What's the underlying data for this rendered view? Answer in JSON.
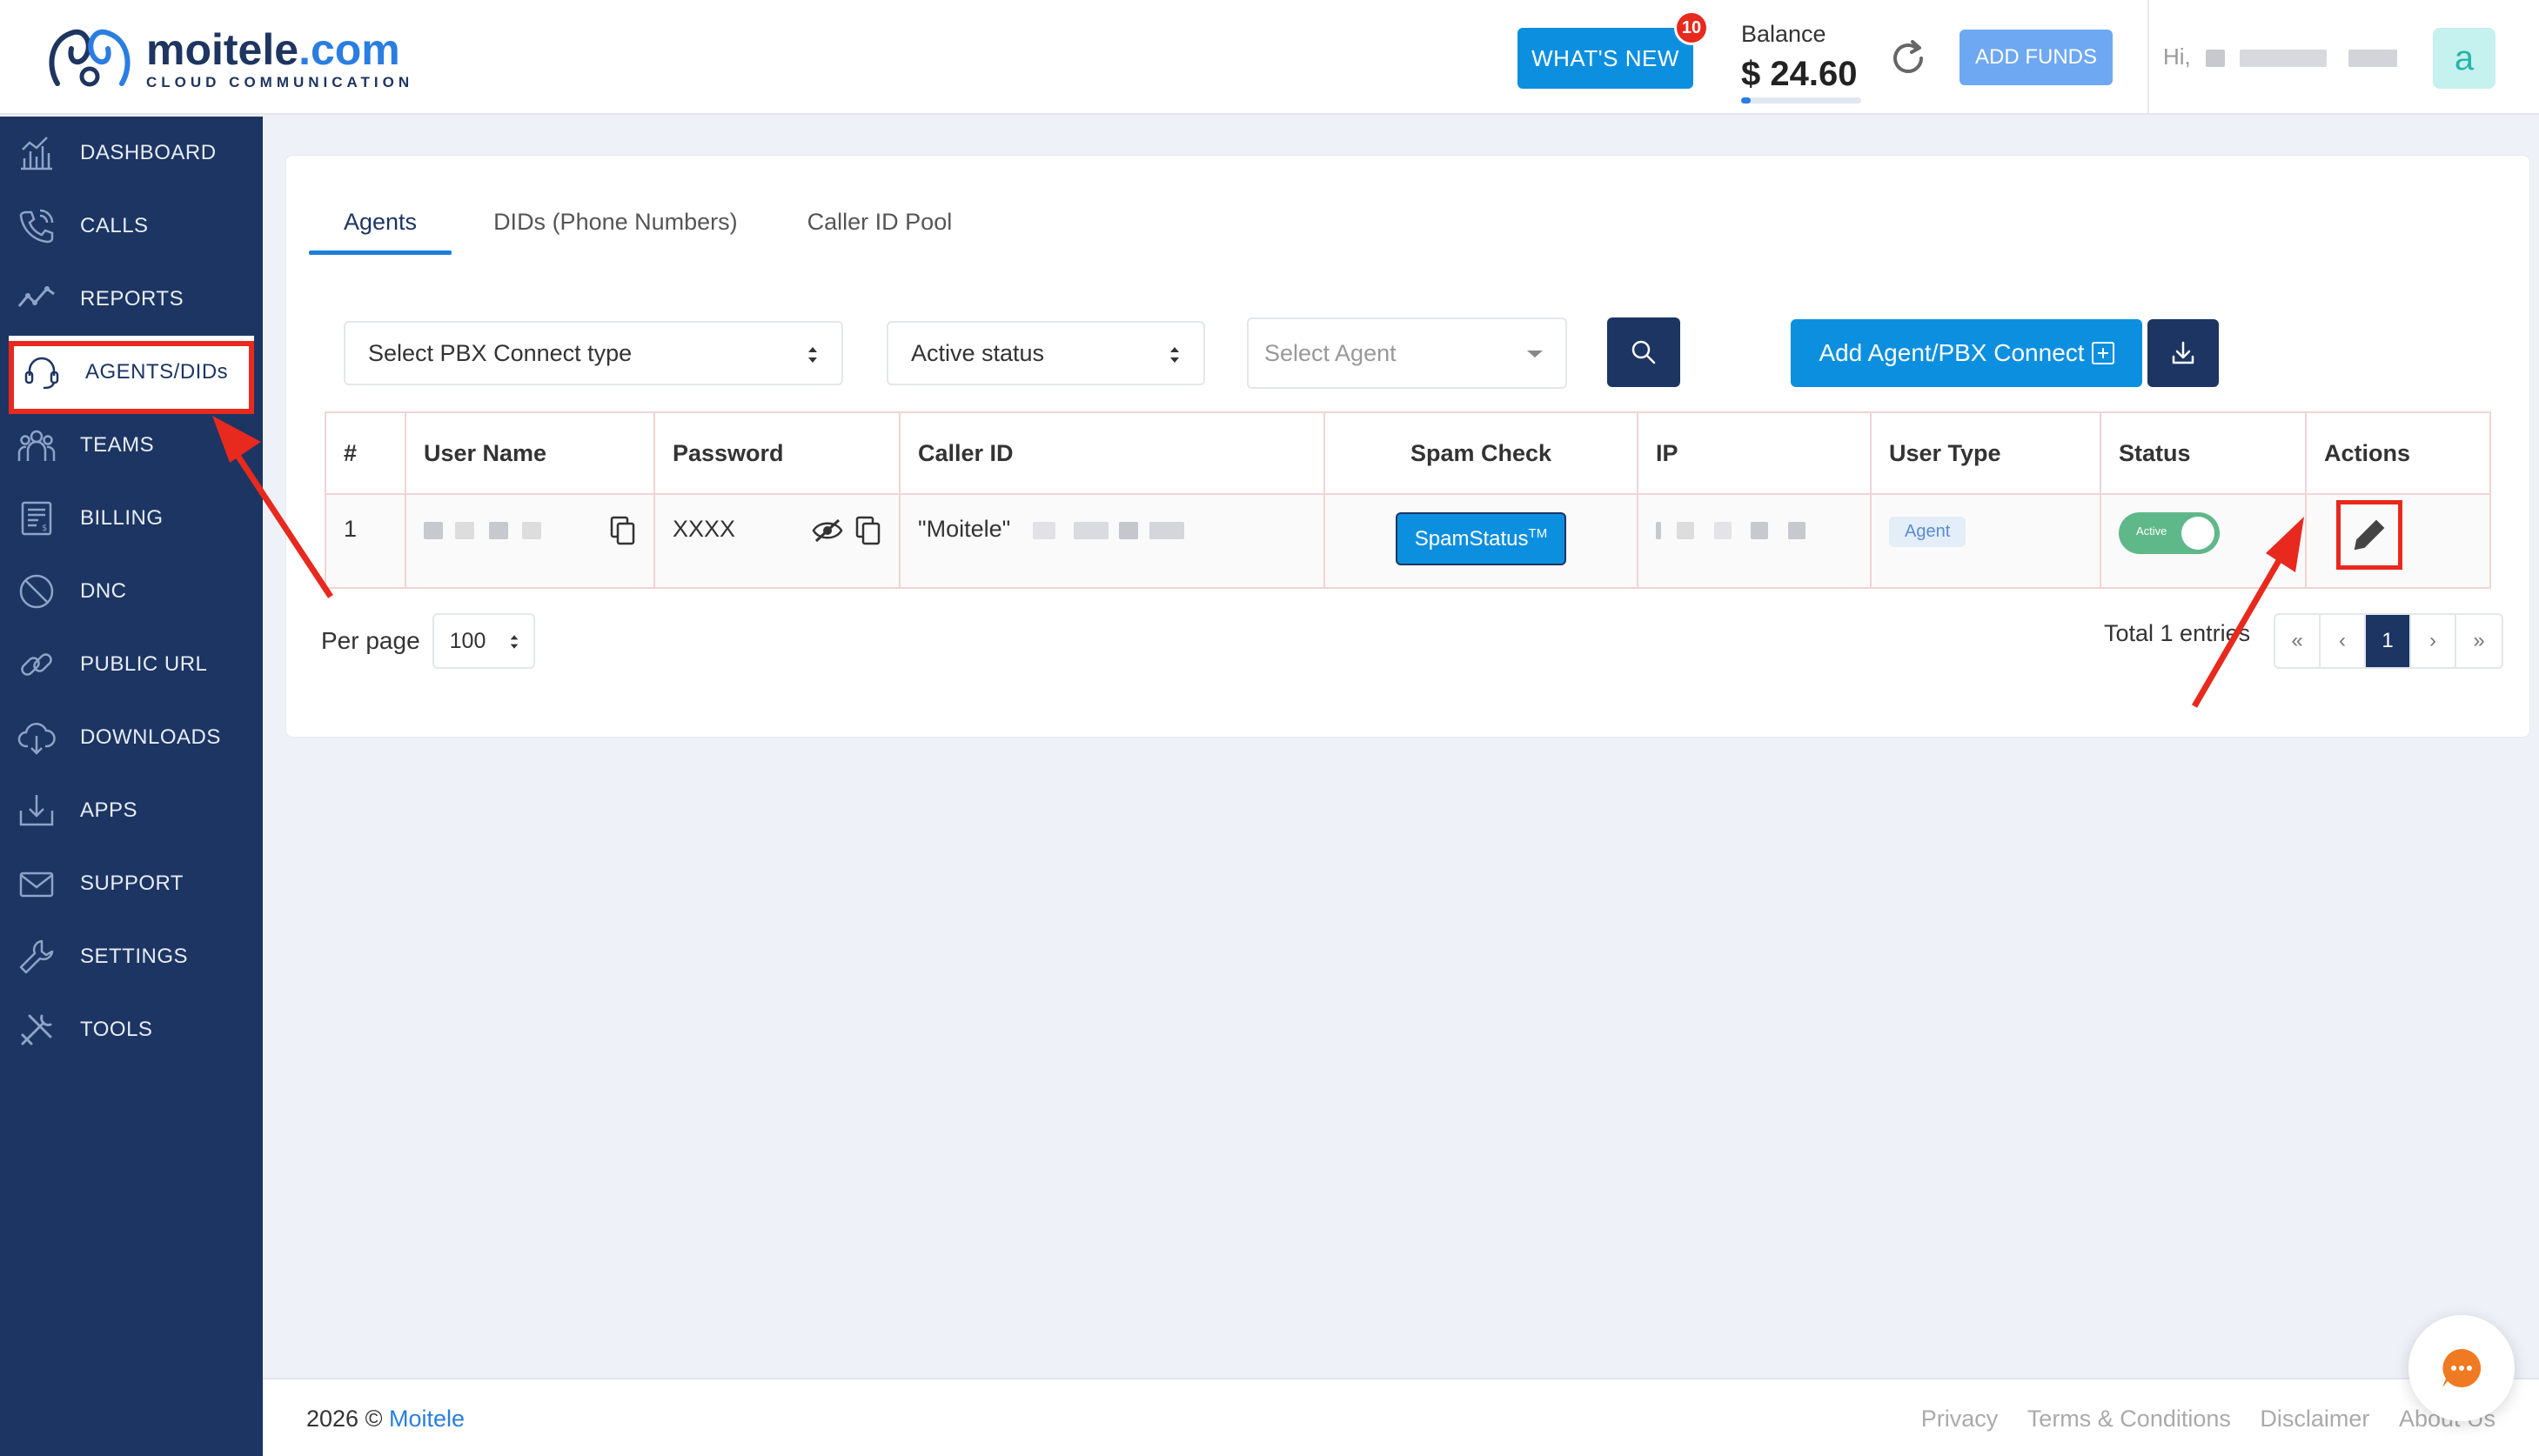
{
  "brand": {
    "name_prefix": "moitele",
    "name_suffix": ".com",
    "tagline": "CLOUD COMMUNICATION"
  },
  "header": {
    "whats_new": "WHAT'S NEW",
    "whats_new_count": "10",
    "balance_label": "Balance",
    "balance_value": "$ 24.60",
    "balance_fill_pct": 8,
    "add_funds": "ADD FUNDS",
    "greeting": "Hi,",
    "avatar_letter": "a"
  },
  "sidebar": {
    "items": [
      {
        "label": "DASHBOARD",
        "icon": "dashboard-icon"
      },
      {
        "label": "CALLS",
        "icon": "calls-icon"
      },
      {
        "label": "REPORTS",
        "icon": "reports-icon"
      },
      {
        "label": "AGENTS/DIDs",
        "icon": "headset-icon",
        "active": true
      },
      {
        "label": "TEAMS",
        "icon": "teams-icon"
      },
      {
        "label": "BILLING",
        "icon": "billing-icon"
      },
      {
        "label": "DNC",
        "icon": "dnc-icon"
      },
      {
        "label": "PUBLIC URL",
        "icon": "link-icon"
      },
      {
        "label": "DOWNLOADS",
        "icon": "cloud-download-icon"
      },
      {
        "label": "APPS",
        "icon": "apps-icon"
      },
      {
        "label": "SUPPORT",
        "icon": "mail-icon"
      },
      {
        "label": "SETTINGS",
        "icon": "wrench-icon"
      },
      {
        "label": "TOOLS",
        "icon": "tools-icon"
      }
    ]
  },
  "tabs": [
    "Agents",
    "DIDs (Phone Numbers)",
    "Caller ID Pool"
  ],
  "filters": {
    "pbx_type": "Select PBX Connect type",
    "status": "Active status",
    "agent_placeholder": "Select Agent",
    "add_button": "Add Agent/PBX Connect"
  },
  "table": {
    "headers": [
      "#",
      "User Name",
      "Password",
      "Caller ID",
      "Spam Check",
      "IP",
      "User Type",
      "Status",
      "Actions"
    ],
    "rows": [
      {
        "num": "1",
        "password": "XXXX",
        "caller_id": "\"Moitele\"",
        "spam_label": "SpamStatus",
        "spam_tm": "TM",
        "user_type": "Agent",
        "status_label": "Active"
      }
    ]
  },
  "pagination": {
    "per_page_label": "Per page",
    "per_page_value": "100",
    "total": "Total 1 entries",
    "first": "«",
    "prev": "‹",
    "current": "1",
    "next": "›",
    "last": "»"
  },
  "footer": {
    "year": "2026 ©",
    "company": "Moitele",
    "links": [
      "Privacy",
      "Terms & Conditions",
      "Disclaimer",
      "About Us"
    ]
  },
  "colors": {
    "sidebar": "#1c3562",
    "primary": "#0d8fe0",
    "annotation": "#e8291e"
  }
}
